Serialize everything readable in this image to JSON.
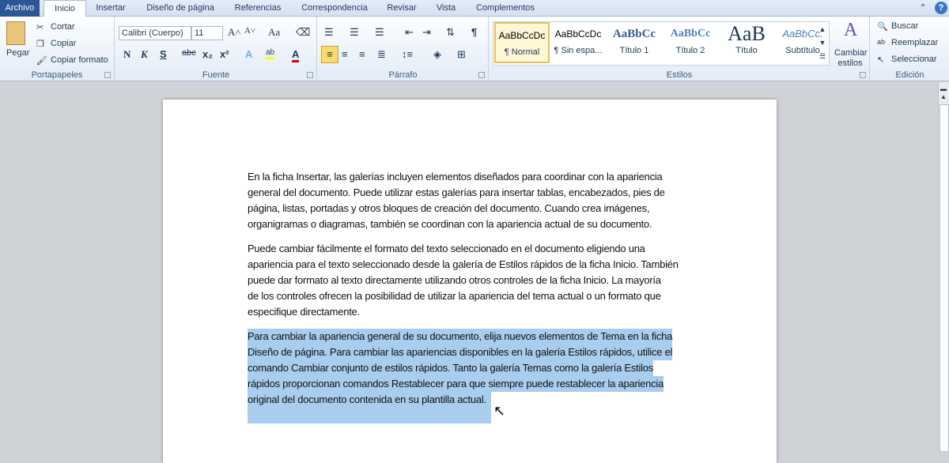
{
  "tabs": [
    "Archivo",
    "Inicio",
    "Insertar",
    "Diseño de página",
    "Referencias",
    "Correspondencia",
    "Revisar",
    "Vista",
    "Complementos"
  ],
  "clipboard": {
    "paste": "Pegar",
    "cut": "Cortar",
    "copy": "Copiar",
    "format_painter": "Copiar formato",
    "label": "Portapapeles"
  },
  "font": {
    "name": "Calibri (Cuerpo)",
    "size": "11",
    "label": "Fuente",
    "bold": "N",
    "italic": "K",
    "underline": "S",
    "change_case": "Aa"
  },
  "paragraph": {
    "label": "Párrafo",
    "pilcrow": "¶"
  },
  "styles": {
    "label": "Estilos",
    "items": [
      {
        "preview": "AaBbCcDc",
        "name": "¶ Normal"
      },
      {
        "preview": "AaBbCcDc",
        "name": "¶ Sin espa..."
      },
      {
        "preview": "AaBbCc",
        "name": "Título 1"
      },
      {
        "preview": "AaBbCc",
        "name": "Título 2"
      },
      {
        "preview": "AaB",
        "name": "Título"
      },
      {
        "preview": "AaBbCc.",
        "name": "Subtítulo"
      }
    ],
    "change": "Cambiar estilos"
  },
  "editing": {
    "label": "Edición",
    "find": "Buscar",
    "replace": "Reemplazar",
    "select": "Seleccionar"
  },
  "document": {
    "paragraphs": [
      {
        "selected": false,
        "lines": [
          "En la ficha Insertar, las galerías incluyen elementos diseñados para coordinar con la apariencia",
          "general del documento. Puede utilizar estas galerías  para insertar tablas, encabezados, pies de",
          "página, listas, portadas y otros bloques de creación del documento. Cuando crea imágenes,",
          "organigramas o diagramas, también se coordinan con la apariencia actual de su documento."
        ]
      },
      {
        "selected": false,
        "lines": [
          "Puede cambiar fácilmente el formato del texto seleccionado en el documento eligiendo una",
          "apariencia para el texto seleccionado desde la galería de Estilos rápidos de la ficha Inicio.  También",
          "puede dar formato al texto directamente utilizando otros controles de la ficha Inicio. La mayoría",
          "de los controles ofrecen la posibilidad de utilizar la apariencia del tema actual o un formato que",
          "especifique directamente."
        ]
      },
      {
        "selected": true,
        "lines": [
          "Para cambiar la apariencia general de su documento, elija nuevos elementos de Tema en la ficha",
          "Diseño de página. Para cambiar las apariencias disponibles en la galería Estilos rápidos, utilice el",
          "comando Cambiar conjunto de estilos rápidos. Tanto la galería Temas como la galería Estilos",
          "rápidos proporcionan comandos Restablecer para que siempre puede restablecer la apariencia",
          "original del documento contenida en su plantilla actual."
        ]
      }
    ]
  }
}
